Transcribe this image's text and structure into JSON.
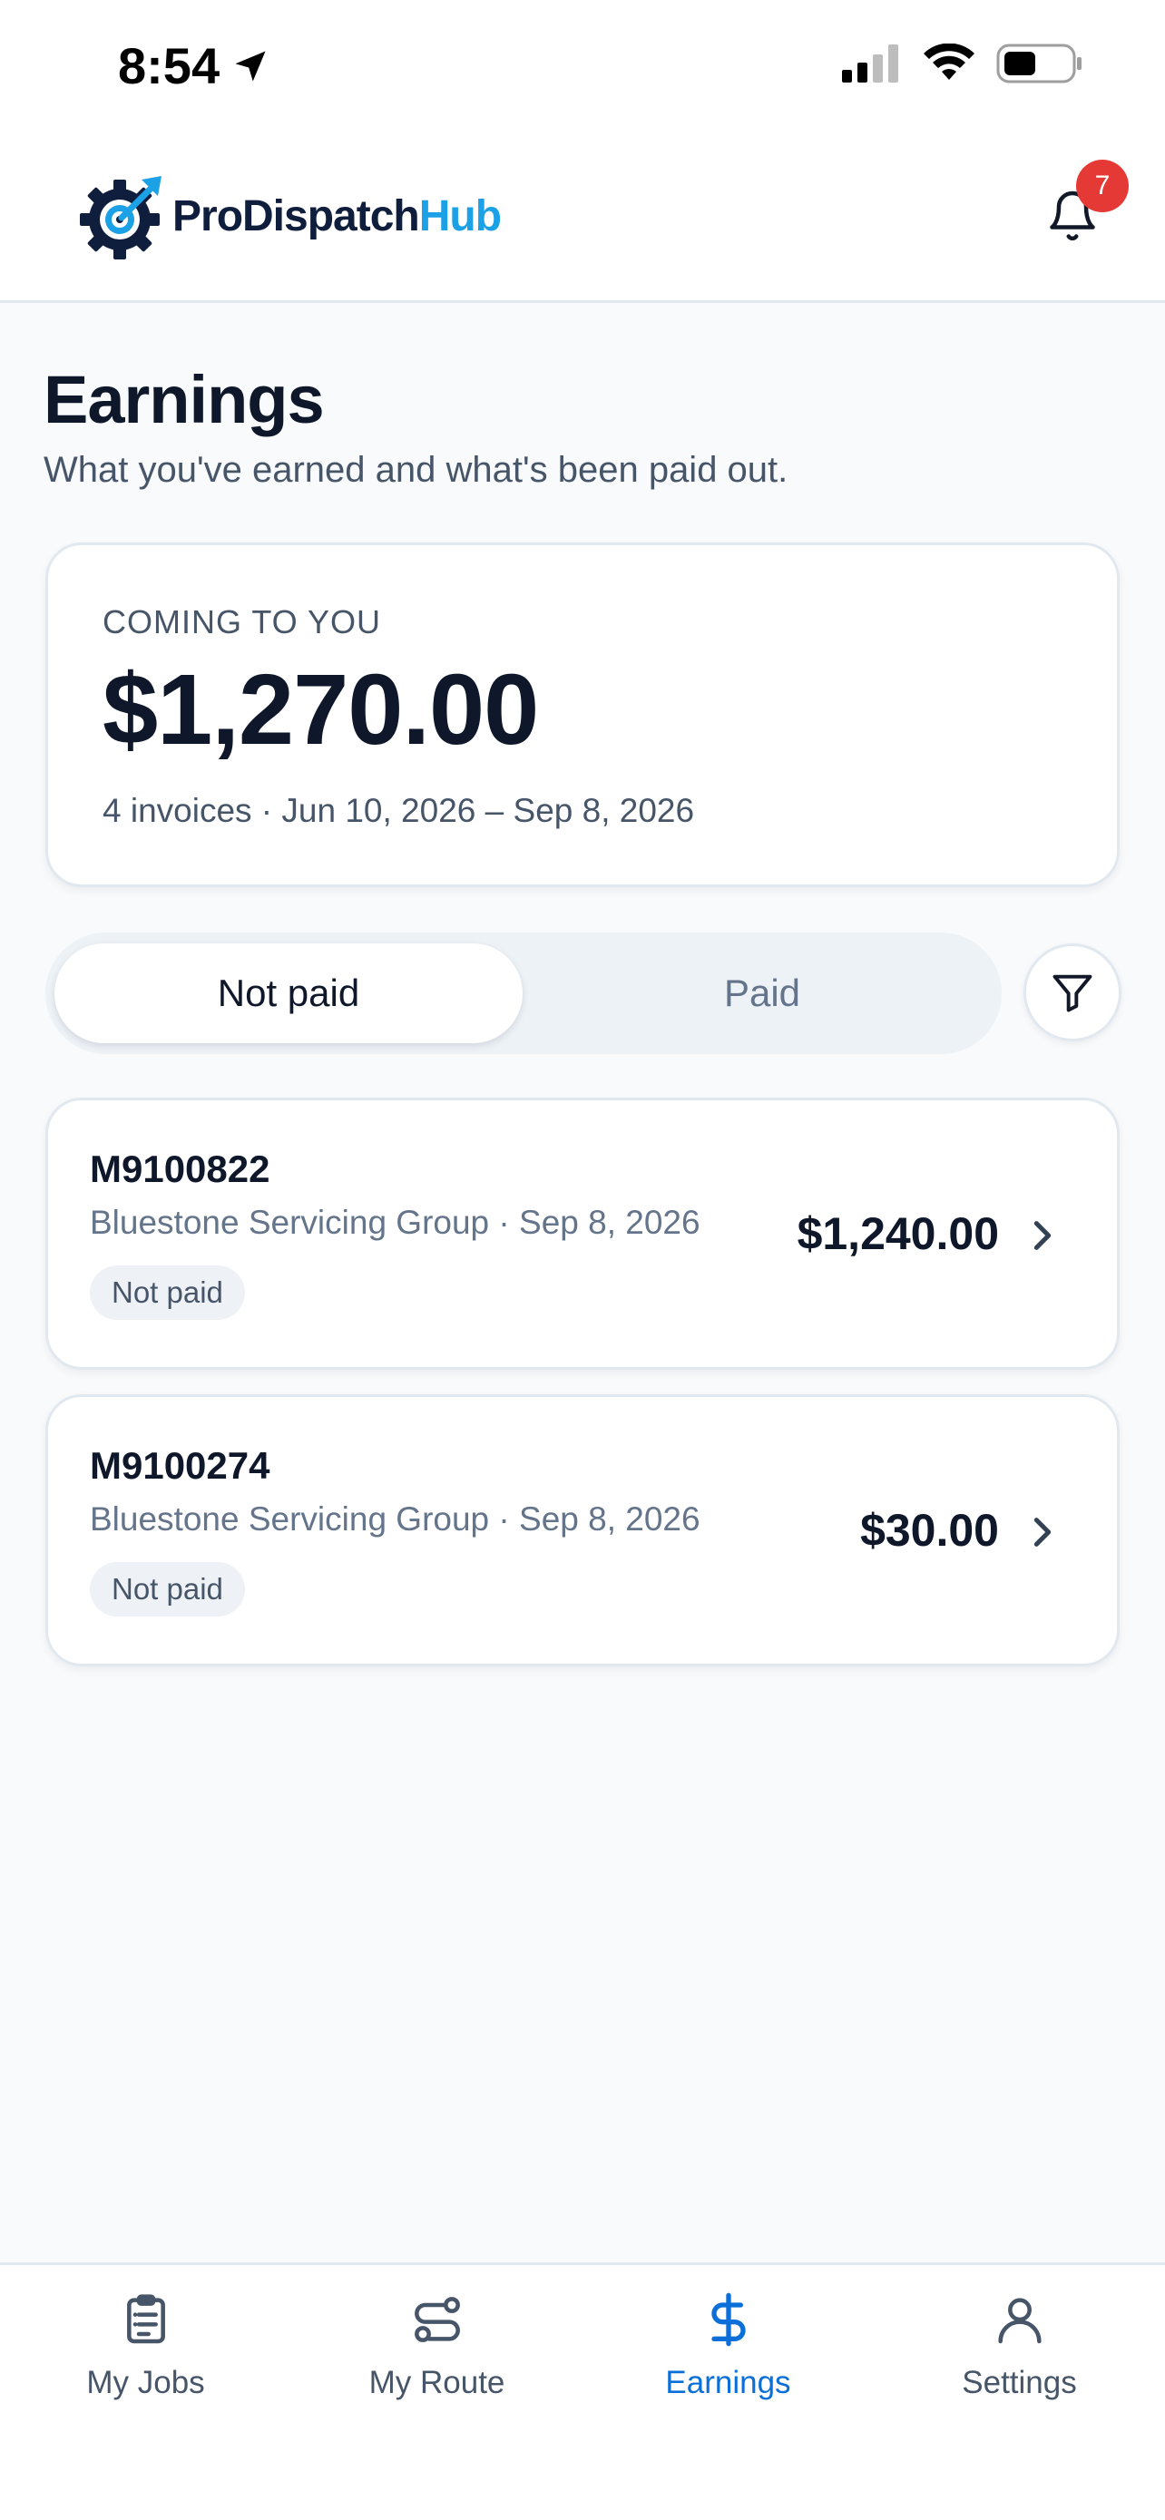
{
  "status_bar": {
    "time": "8:54"
  },
  "header": {
    "logo_pro": "ProDispatch",
    "logo_hub": "Hub",
    "notification_count": "7"
  },
  "page": {
    "title": "Earnings",
    "subtitle": "What you've earned and what's been paid out."
  },
  "summary": {
    "label": "COMING TO YOU",
    "amount": "$1,270.00",
    "meta": "4 invoices · Jun 10, 2026 – Sep 8, 2026"
  },
  "tabs": {
    "active": "Not paid",
    "inactive": "Paid"
  },
  "invoices": [
    {
      "id": "M9100822",
      "meta": "Bluestone Servicing Group · Sep 8, 2026",
      "status": "Not paid",
      "amount": "$1,240.00"
    },
    {
      "id": "M9100274",
      "meta": "Bluestone Servicing Group · Sep 8, 2026",
      "status": "Not paid",
      "amount": "$30.00"
    }
  ],
  "nav": [
    {
      "label": "My Jobs",
      "icon": "clipboard-icon"
    },
    {
      "label": "My Route",
      "icon": "route-icon"
    },
    {
      "label": "Earnings",
      "icon": "dollar-icon"
    },
    {
      "label": "Settings",
      "icon": "user-icon"
    }
  ],
  "colors": {
    "accent": "#0A6FD8",
    "brand_dark": "#0F1E3D",
    "brand_light": "#1DA1E6",
    "badge": "#E53935"
  }
}
